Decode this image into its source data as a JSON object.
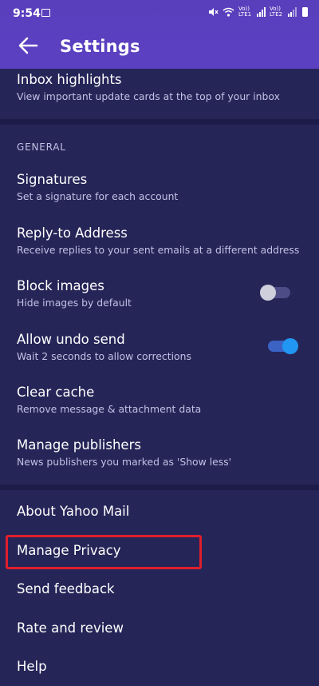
{
  "status_bar": {
    "time": "9:54",
    "volte1": "Vo)) LTE1",
    "volte2": "Vo)) LTE2",
    "icons": [
      "gallery-icon",
      "mute-icon",
      "wifi-icon",
      "signal-icon",
      "battery-icon"
    ]
  },
  "header": {
    "title": "Settings",
    "back_icon": "arrow-left-icon"
  },
  "inbox_highlights": {
    "title": "Inbox highlights",
    "subtitle": "View important update cards at the top of your inbox"
  },
  "general": {
    "header": "GENERAL",
    "items": [
      {
        "title": "Signatures",
        "subtitle": "Set a signature for each account"
      },
      {
        "title": "Reply-to Address",
        "subtitle": "Receive replies to your sent emails at a different address"
      },
      {
        "title": "Block images",
        "subtitle": "Hide images by default",
        "toggle": false
      },
      {
        "title": "Allow undo send",
        "subtitle": "Wait 2 seconds to allow corrections",
        "toggle": true
      },
      {
        "title": "Clear cache",
        "subtitle": "Remove message & attachment data"
      },
      {
        "title": "Manage publishers",
        "subtitle": "News publishers you marked as 'Show less'"
      }
    ]
  },
  "about": {
    "items": [
      {
        "title": "About Yahoo Mail"
      },
      {
        "title": "Manage Privacy"
      },
      {
        "title": "Send feedback"
      },
      {
        "title": "Rate and review"
      },
      {
        "title": "Help"
      }
    ]
  },
  "colors": {
    "background": "#262558",
    "header": "#5b41c2",
    "toggle_on": "#2196f3",
    "highlight": "#e01e2b"
  }
}
